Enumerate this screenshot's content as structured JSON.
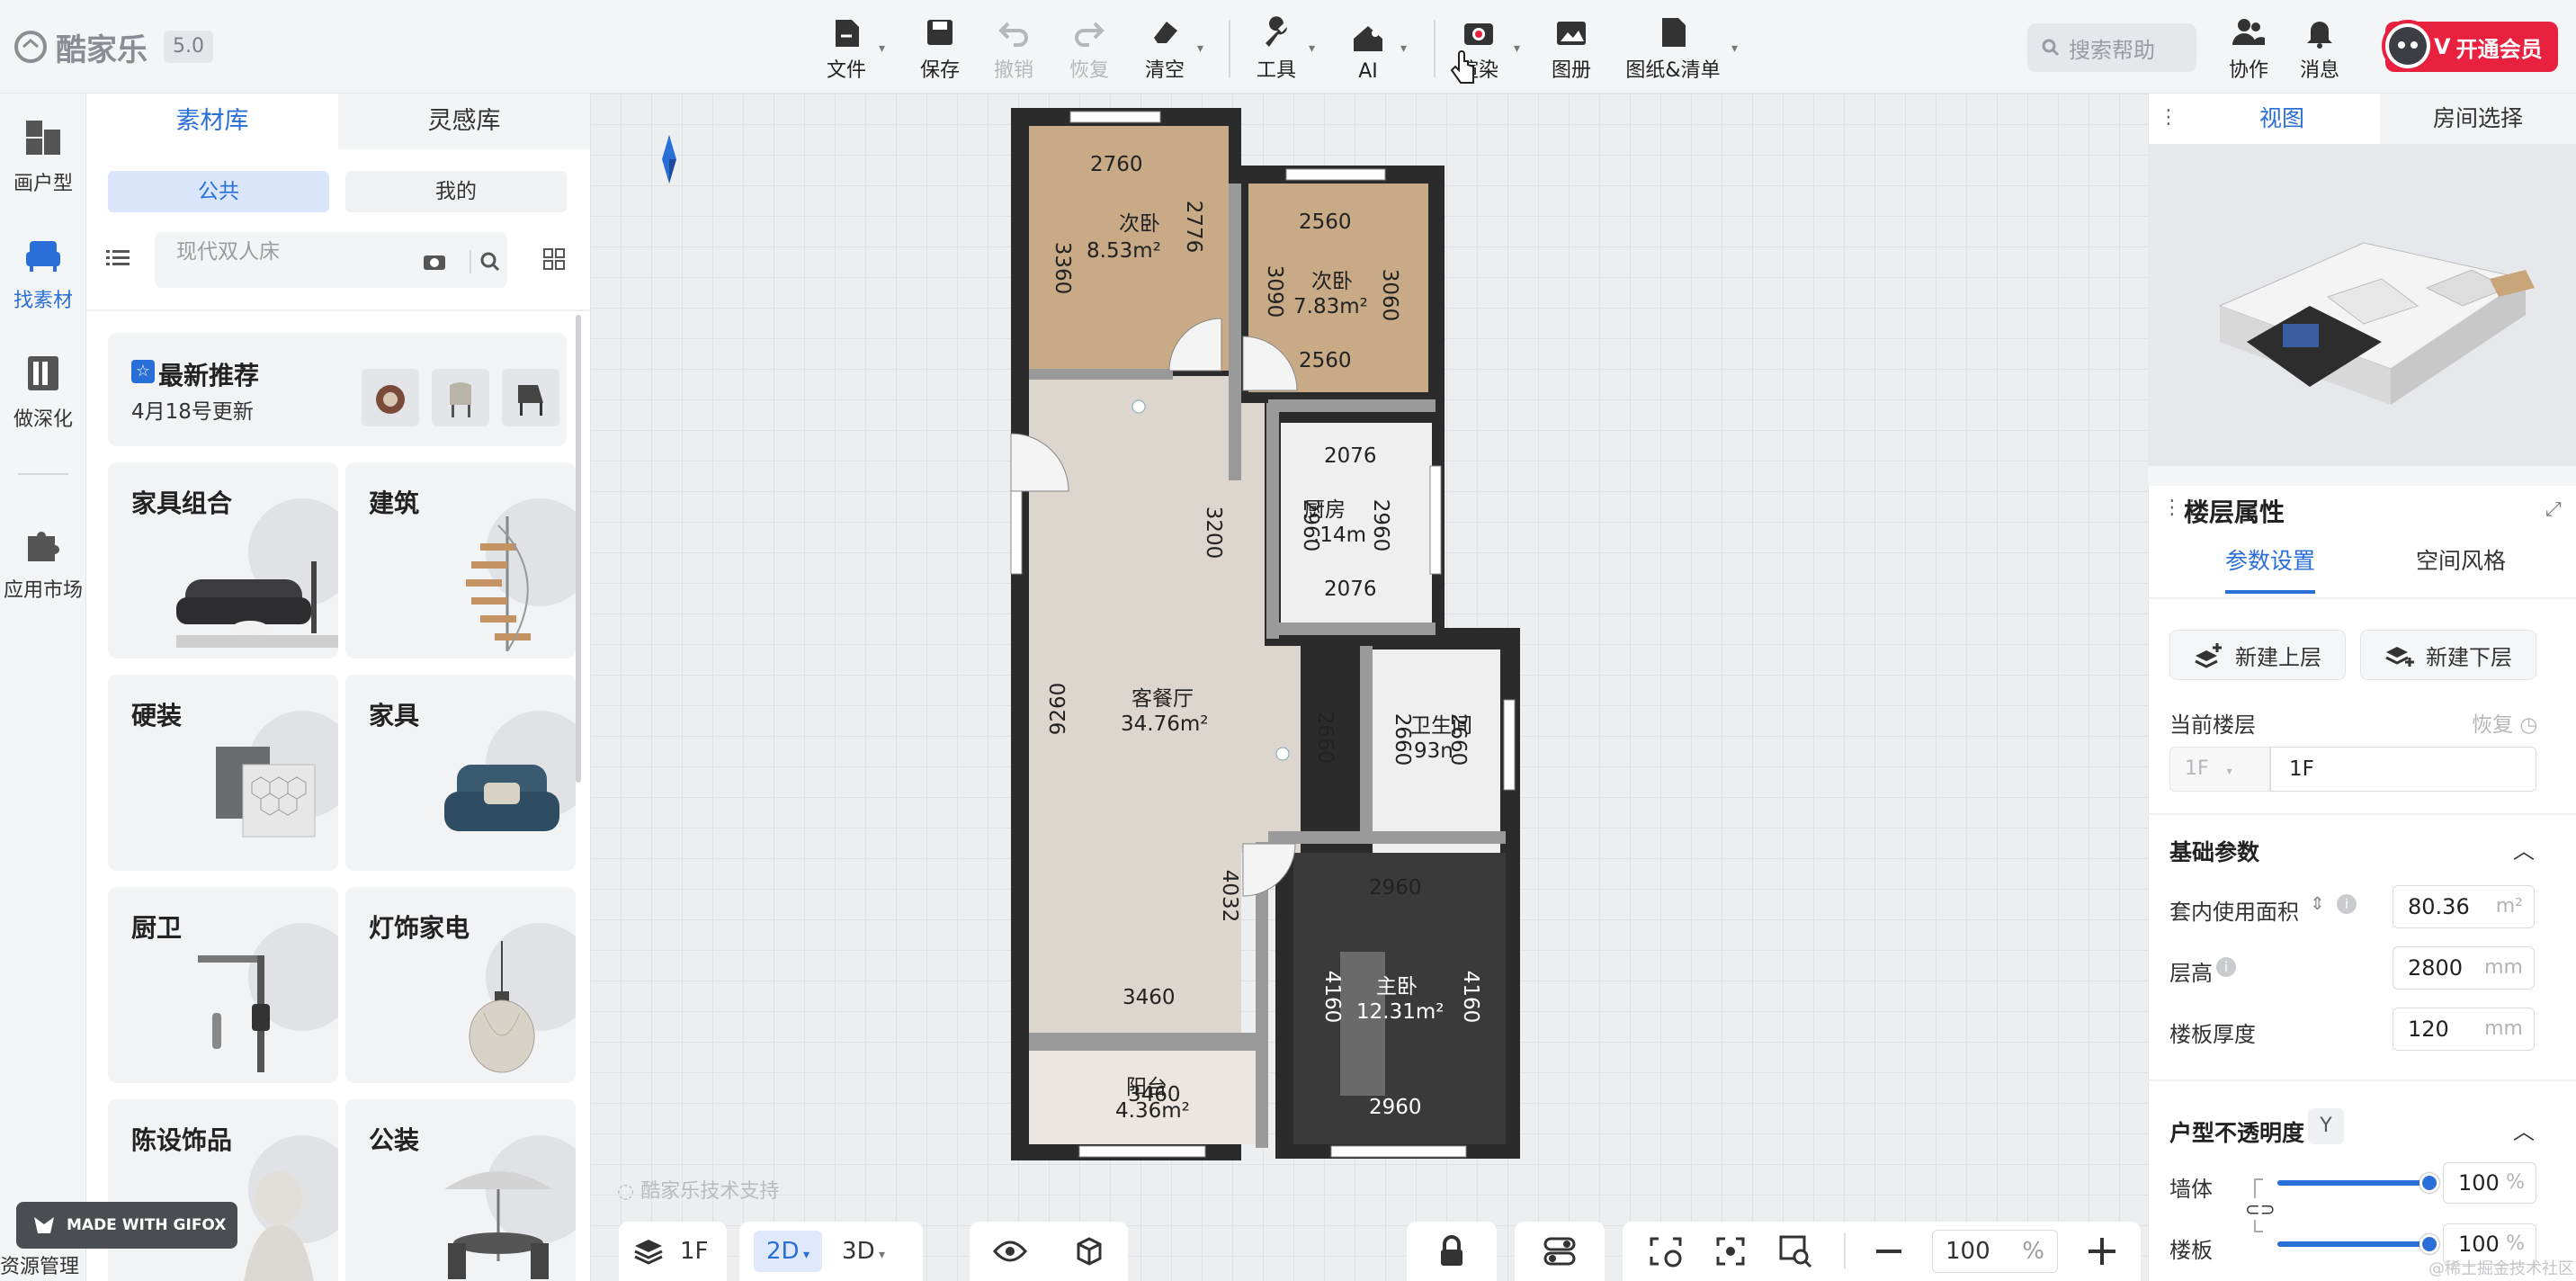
{
  "app": {
    "logo_text": "酷家乐",
    "version": "5.0"
  },
  "toolbar": {
    "file": "文件",
    "save": "保存",
    "undo": "撤销",
    "redo": "恢复",
    "clear": "清空",
    "tools": "工具",
    "ai": "AI",
    "render": "渲染",
    "album": "图册",
    "drawings": "图纸&清单"
  },
  "search_help": {
    "placeholder": "搜索帮助"
  },
  "header_right": {
    "collab": "协作",
    "messages": "消息",
    "vip": "开通会员"
  },
  "rail": [
    {
      "label": "画户型",
      "icon": "floorplan-icon"
    },
    {
      "label": "找素材",
      "icon": "sofa-icon",
      "active": true
    },
    {
      "label": "做深化",
      "icon": "deepen-icon"
    },
    {
      "label": "应用市场",
      "icon": "puzzle-icon"
    }
  ],
  "rail_bottom": "资源管理",
  "asset_panel": {
    "tabs": [
      "素材库",
      "灵感库"
    ],
    "scope": [
      "公共",
      "我的"
    ],
    "search_placeholder": "现代双人床",
    "recommend_title": "最新推荐",
    "recommend_sub": "4月18号更新",
    "categories": [
      "家具组合",
      "建筑",
      "硬装",
      "家具",
      "厨卫",
      "灯饰家电",
      "陈设饰品",
      "公装"
    ]
  },
  "canvas": {
    "watermark": "酷家乐技术支持",
    "rooms": [
      {
        "name": "次卧",
        "area": "8.53m²"
      },
      {
        "name": "次卧",
        "area": "7.83m²"
      },
      {
        "name": "厨房",
        "area": ".14m"
      },
      {
        "name": "客餐厅",
        "area": "34.76m²"
      },
      {
        "name": "卫生间",
        "area": "93n"
      },
      {
        "name": "主卧",
        "area": "12.31m²"
      },
      {
        "name": "阳台",
        "area": "4.36m²"
      }
    ],
    "dims": [
      "2760",
      "3360",
      "2776",
      "2560",
      "3090",
      "3060",
      "2560",
      "2076",
      "2960",
      "2960",
      "2076",
      "3200",
      "9260",
      "2660",
      "2660",
      "2660",
      "2960",
      "4032",
      "4160",
      "4160",
      "3460",
      "3460",
      "2960"
    ]
  },
  "bottom_bar": {
    "floor": "1F",
    "mode_2d": "2D",
    "mode_3d": "3D",
    "zoom": "100",
    "zoom_unit": "%"
  },
  "right_panel": {
    "tabs": [
      "视图",
      "房间选择"
    ],
    "floor_props_title": "楼层属性",
    "prop_tabs": [
      "参数设置",
      "空间风格"
    ],
    "new_upper": "新建上层",
    "new_lower": "新建下层",
    "current_floor_label": "当前楼层",
    "restore": "恢复",
    "floor_select": "1F",
    "floor_name": "1F",
    "basic_params": "基础参数",
    "inner_area_label": "套内使用面积",
    "inner_area_value": "80.36",
    "inner_area_unit": "m²",
    "height_label": "层高",
    "height_value": "2800",
    "height_unit": "mm",
    "slab_label": "楼板厚度",
    "slab_value": "120",
    "slab_unit": "mm",
    "opacity_title": "户型不透明度",
    "opacity_toggle": "Y",
    "wall_label": "墙体",
    "wall_value": "100",
    "floor_label": "楼板",
    "floor_value": "100",
    "pct": "%"
  },
  "overlay": {
    "gifox": "MADE WITH GIFOX",
    "credit": "@稀土掘金技术社区"
  },
  "colors": {
    "accent": "#2a6fd8",
    "vip": "#e8213e",
    "wall": "#2b2b2b",
    "wood": "#c8ab86",
    "living": "#ddd6ce",
    "master": "#3a3a3a"
  }
}
